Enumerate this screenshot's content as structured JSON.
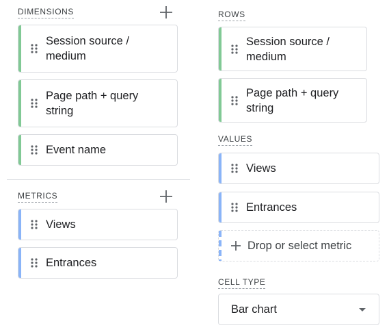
{
  "left_panel": {
    "dimensions": {
      "label": "DIMENSIONS",
      "items": [
        "Session source / medium",
        "Page path + query string",
        "Event name"
      ]
    },
    "metrics": {
      "label": "METRICS",
      "items": [
        "Views",
        "Entrances"
      ]
    }
  },
  "right_panel": {
    "rows": {
      "label": "ROWS",
      "items": [
        "Session source / medium",
        "Page path + query string"
      ]
    },
    "values": {
      "label": "VALUES",
      "items": [
        "Views",
        "Entrances"
      ],
      "drop_placeholder": "Drop or select metric"
    },
    "cell_type": {
      "label": "CELL TYPE",
      "selected": "Bar chart"
    }
  },
  "colors": {
    "dimension_accent": "#81c995",
    "metric_accent": "#8ab4f8"
  },
  "icons": {
    "add": "plus-icon",
    "handle": "drag-handle-icon",
    "caret": "dropdown-caret-icon"
  }
}
